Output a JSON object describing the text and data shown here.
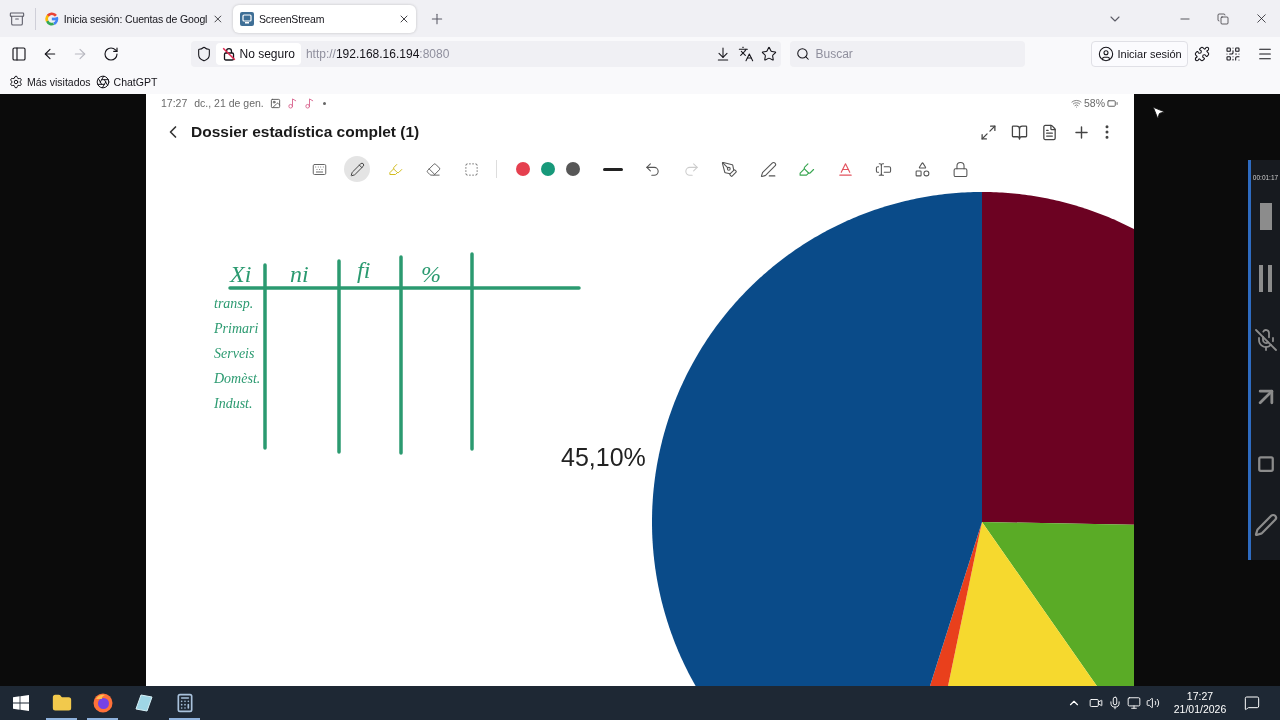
{
  "browser": {
    "tabs": [
      {
        "title": "Inicia sesión: Cuentas de Googl",
        "selected": false
      },
      {
        "title": "ScreenStream",
        "selected": true
      }
    ],
    "nav_buttons": [
      {
        "disabled": false
      },
      {
        "disabled": true
      }
    ],
    "security_label": "No seguro",
    "url": {
      "scheme": "http://",
      "host": "192.168.16.194",
      "port": ":8080"
    },
    "search": {
      "placeholder": "Buscar"
    },
    "sign_in": "Iniciar sesión",
    "bookmarks": [
      "Más visitados",
      "ChatGPT"
    ]
  },
  "phone": {
    "status_bar": {
      "time": "17:27",
      "date": "dc., 21 de gen.",
      "battery": "58%"
    },
    "title": "Dossier estadística complet (1)",
    "toolbar": {
      "tools": [
        {
          "selected": false
        },
        {
          "selected": true
        },
        {
          "selected": false
        },
        {
          "selected": false
        },
        {
          "selected": false
        }
      ],
      "pen_colors": [
        {
          "color": "#e5404f"
        },
        {
          "color": "#17997a"
        },
        {
          "color": "#575757"
        }
      ],
      "history": [
        {
          "disabled": false
        },
        {
          "disabled": true
        }
      ]
    },
    "canvas": {
      "table_headers": [
        "Xi",
        "ni",
        "fi",
        "%"
      ],
      "table_rows": [
        "transp.",
        "Primari",
        "Serveis",
        "Domèst.",
        "Indust."
      ],
      "pie_label": "45,10%"
    }
  },
  "recorder": {
    "elapsed": "00:01:17"
  },
  "taskbar": {
    "apps": [
      {
        "running": true
      },
      {
        "running": true
      },
      {
        "running": false
      },
      {
        "running": true
      }
    ],
    "clock": {
      "time": "17:27",
      "date": "21/01/2026"
    }
  }
}
